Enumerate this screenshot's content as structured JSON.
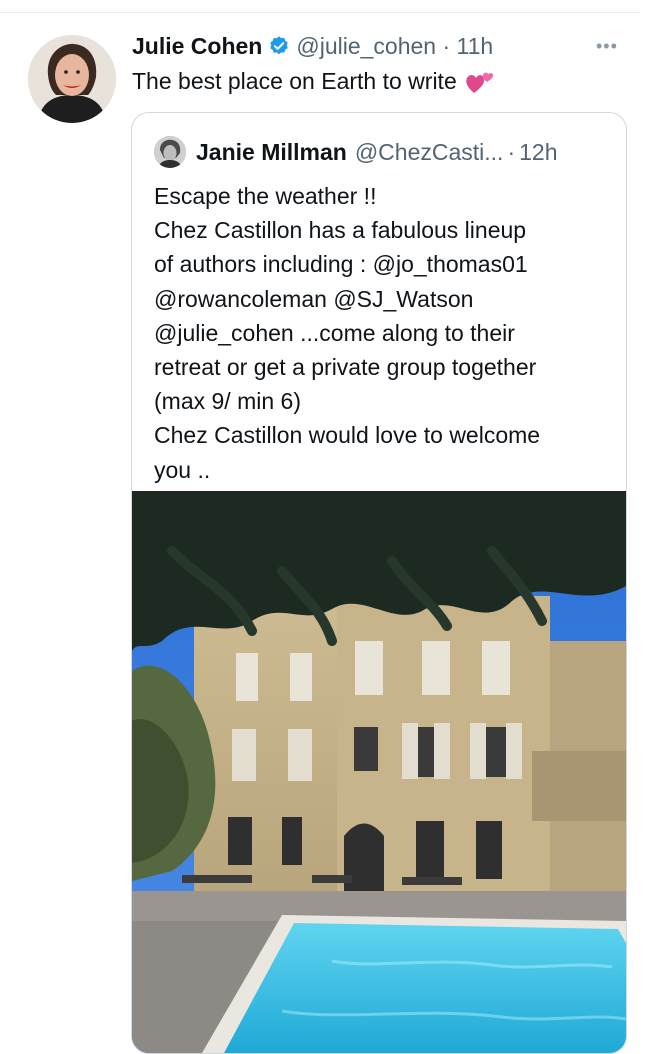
{
  "tweet": {
    "author_name": "Julie Cohen",
    "handle": "@julie_cohen",
    "time": "11h",
    "text": "The best place on Earth to write",
    "emoji_icon": "two-hearts-icon",
    "verified_icon": "verified-badge-icon",
    "more_icon": "more-options-icon"
  },
  "quoted": {
    "author_name": "Janie Millman",
    "handle": "@ChezCasti...",
    "time": "12h",
    "lines": [
      "Escape the weather !!",
      "Chez Castillon has a fabulous lineup",
      "of authors including : @jo_thomas01",
      "@rowancoleman @SJ_Watson",
      "@julie_cohen ...come along to  their",
      "retreat or get a private group together",
      "(max 9/ min 6)",
      "Chez Castillon would love to welcome",
      "you .."
    ]
  },
  "colors": {
    "text": "#0f1419",
    "secondary": "#536471",
    "verified": "#1d9bf0",
    "border": "#cfd9de",
    "pool": "#3ec3e6"
  }
}
